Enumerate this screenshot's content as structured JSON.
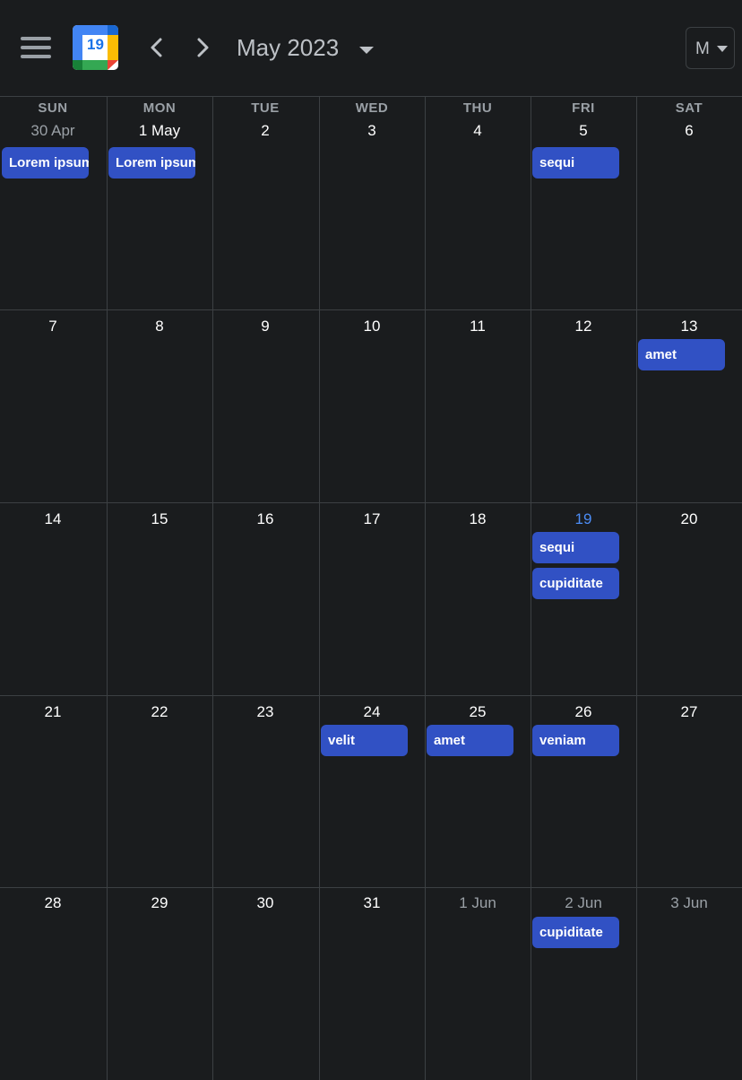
{
  "header": {
    "logo_day": "19",
    "month_title": "May 2023",
    "view_label": "M"
  },
  "weekdays": [
    "SUN",
    "MON",
    "TUE",
    "WED",
    "THU",
    "FRI",
    "SAT"
  ],
  "weeks": [
    [
      "30 Apr",
      "1 May",
      "2",
      "3",
      "4",
      "5",
      "6"
    ],
    [
      "7",
      "8",
      "9",
      "10",
      "11",
      "12",
      "13"
    ],
    [
      "14",
      "15",
      "16",
      "17",
      "18",
      "19",
      "20"
    ],
    [
      "21",
      "22",
      "23",
      "24",
      "25",
      "26",
      "27"
    ],
    [
      "28",
      "29",
      "30",
      "31",
      "1 Jun",
      "2 Jun",
      "3 Jun"
    ]
  ],
  "events": [
    {
      "week": 0,
      "day": 0,
      "title": "Lorem ipsum"
    },
    {
      "week": 0,
      "day": 1,
      "title": "Lorem ipsum"
    },
    {
      "week": 0,
      "day": 5,
      "title": "sequi"
    },
    {
      "week": 1,
      "day": 6,
      "title": "amet"
    },
    {
      "week": 2,
      "day": 5,
      "title": "sequi"
    },
    {
      "week": 2,
      "day": 5,
      "title": "cupiditate"
    },
    {
      "week": 3,
      "day": 3,
      "title": "velit"
    },
    {
      "week": 3,
      "day": 4,
      "title": "amet"
    },
    {
      "week": 3,
      "day": 5,
      "title": "veniam"
    },
    {
      "week": 4,
      "day": 5,
      "title": "cupiditate"
    }
  ],
  "colors": {
    "background": "#1a1c1e",
    "event": "#3151c4",
    "today": "#4c8df6",
    "muted": "#9aa0a6",
    "gridline": "#3c4043"
  }
}
